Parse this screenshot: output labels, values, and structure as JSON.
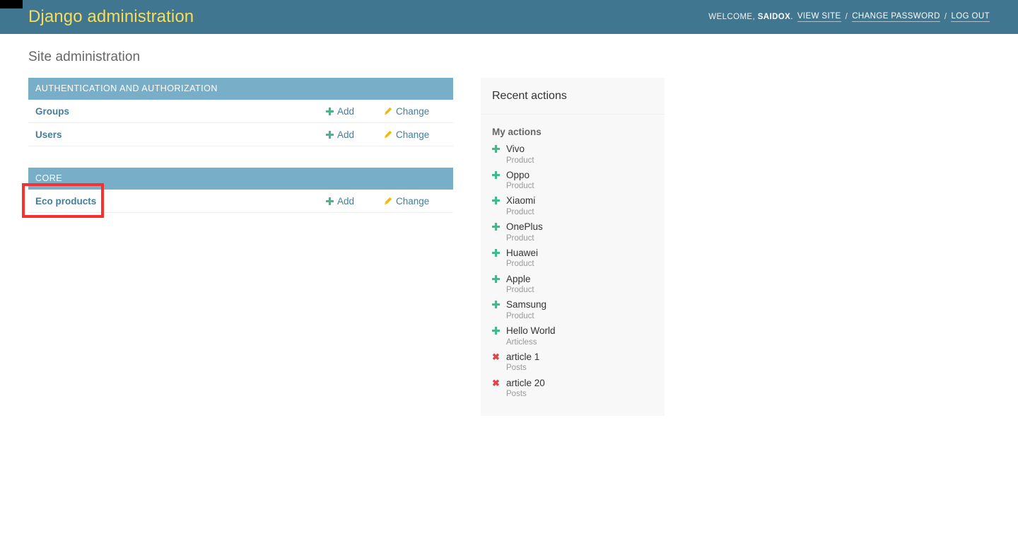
{
  "header": {
    "branding": "Django administration",
    "welcome_label": "WELCOME,",
    "username": "SAIDOX",
    "username_suffix": ".",
    "view_site": "VIEW SITE",
    "change_password": "CHANGE PASSWORD",
    "log_out": "LOG OUT",
    "separator": "/",
    "bar_color": "#417690",
    "branding_color": "#f5dd5d"
  },
  "page": {
    "title": "Site administration"
  },
  "modules": [
    {
      "caption": "AUTHENTICATION AND AUTHORIZATION",
      "caption_color": "#79aec8",
      "rows": [
        {
          "name": "Groups",
          "add_label": "Add",
          "change_label": "Change",
          "add_icon": "plus-icon",
          "change_icon": "pencil-icon"
        },
        {
          "name": "Users",
          "add_label": "Add",
          "change_label": "Change",
          "add_icon": "plus-icon",
          "change_icon": "pencil-icon"
        }
      ]
    },
    {
      "caption": "CORE",
      "caption_color": "#79aec8",
      "rows": [
        {
          "name": "Eco products",
          "add_label": "Add",
          "change_label": "Change",
          "add_icon": "plus-icon",
          "change_icon": "pencil-icon"
        }
      ]
    }
  ],
  "recent_actions": {
    "title": "Recent actions",
    "subtitle": "My actions",
    "items": [
      {
        "object": "Vivo",
        "ctype": "Product",
        "icon": "plus-icon",
        "action": "addition"
      },
      {
        "object": "Oppo",
        "ctype": "Product",
        "icon": "plus-icon",
        "action": "addition"
      },
      {
        "object": "Xiaomi",
        "ctype": "Product",
        "icon": "plus-icon",
        "action": "addition"
      },
      {
        "object": "OnePlus",
        "ctype": "Product",
        "icon": "plus-icon",
        "action": "addition"
      },
      {
        "object": "Huawei",
        "ctype": "Product",
        "icon": "plus-icon",
        "action": "addition"
      },
      {
        "object": "Apple",
        "ctype": "Product",
        "icon": "plus-icon",
        "action": "addition"
      },
      {
        "object": "Samsung",
        "ctype": "Product",
        "icon": "plus-icon",
        "action": "addition"
      },
      {
        "object": "Hello World",
        "ctype": "Articless",
        "icon": "plus-icon",
        "action": "addition"
      },
      {
        "object": "article 1",
        "ctype": "Posts",
        "icon": "x-icon",
        "action": "deletion"
      },
      {
        "object": "article 20",
        "ctype": "Posts",
        "icon": "x-icon",
        "action": "deletion"
      }
    ]
  },
  "annotation": {
    "target": "Eco products",
    "color": "#f8312f"
  }
}
